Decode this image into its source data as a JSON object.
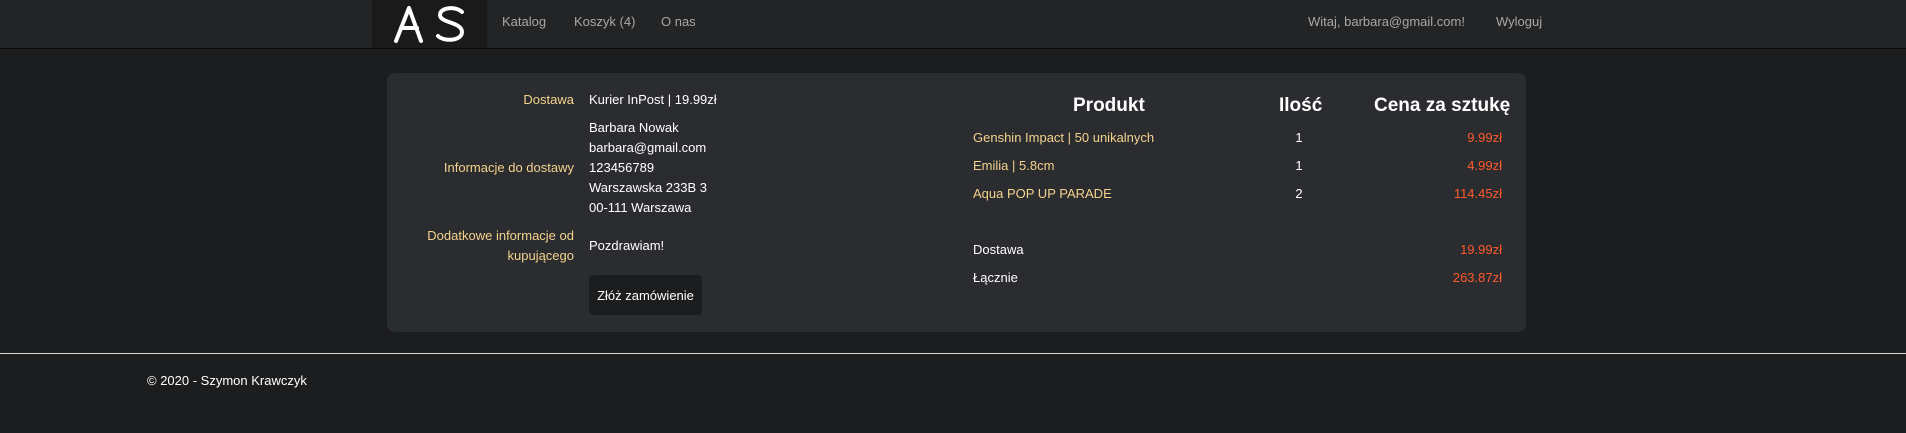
{
  "navbar": {
    "logo_text": "AS",
    "links": [
      "Katalog",
      "Koszyk (4)",
      "O nas"
    ],
    "greeting": "Witaj, barbara@gmail.com!",
    "logout": "Wyloguj"
  },
  "order": {
    "delivery_label": "Dostawa",
    "delivery_value": "Kurier InPost | 19.99zł",
    "shipping_info_label": "Informacje do dostawy",
    "shipping_info_lines": [
      "Barbara Nowak",
      "barbara@gmail.com",
      "123456789",
      "Warszawska 233B 3",
      "00-111 Warszawa"
    ],
    "extra_info_label_lines": [
      "Dodatkowe informacje od",
      "kupującego"
    ],
    "extra_info_value": "Pozdrawiam!",
    "submit_label": "Złóż zamówienie"
  },
  "table": {
    "headers": [
      "Produkt",
      "Ilość",
      "Cena za sztukę"
    ],
    "rows": [
      {
        "product": "Genshin Impact | 50 unikalnych",
        "qty": "1",
        "price": "9.99zł"
      },
      {
        "product": "Emilia | 5.8cm",
        "qty": "1",
        "price": "4.99zł"
      },
      {
        "product": "Aqua POP UP PARADE",
        "qty": "2",
        "price": "114.45zł"
      }
    ],
    "delivery_label": "Dostawa",
    "delivery_price": "19.99zł",
    "total_label": "Łącznie",
    "total_price": "263.87zł"
  },
  "footer": {
    "text": "© 2020 - Szymon Krawczyk"
  },
  "colors": {
    "accent_label": "#f3d28d",
    "price": "#ff5a2c",
    "background": "#1c1d1f",
    "card": "#2b2c2f"
  }
}
